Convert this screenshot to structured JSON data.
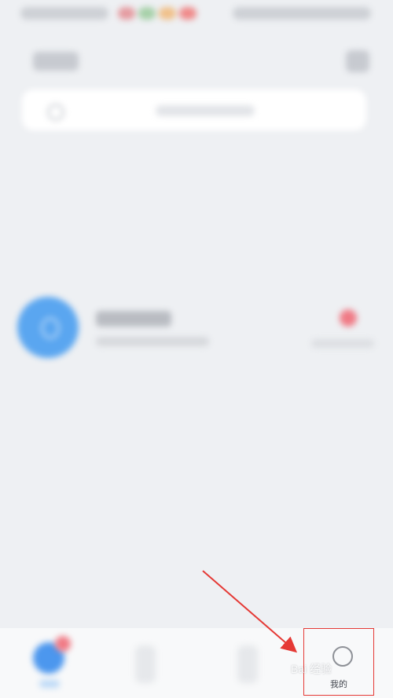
{
  "tab_bar": {
    "profile_label": "我的"
  },
  "watermark": {
    "text": "Bai 经验"
  },
  "colors": {
    "accent_blue": "#5aa6f0",
    "badge_red": "#f07a85",
    "annotation_red": "#e53935",
    "background": "#eef0f3"
  },
  "icons": {
    "search": "search-icon",
    "menu": "menu-icon",
    "profile": "user-icon",
    "messages": "chat-icon"
  }
}
